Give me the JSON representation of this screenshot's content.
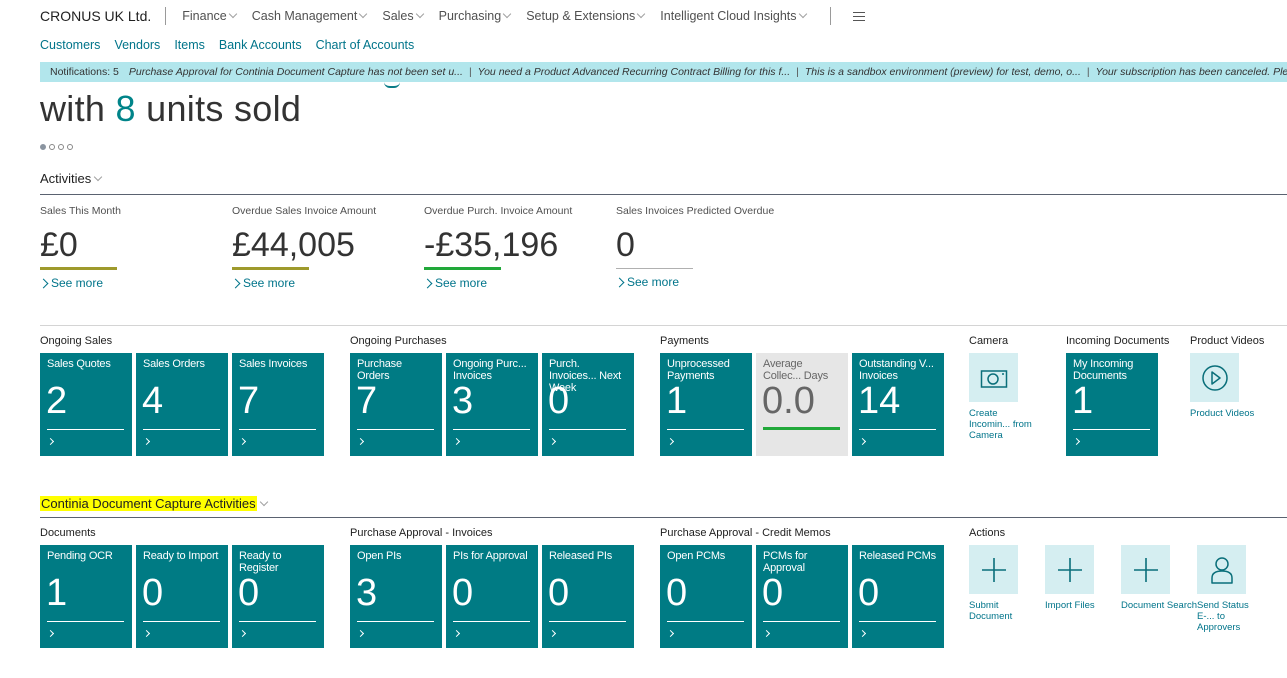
{
  "nav": {
    "company": "CRONUS UK Ltd.",
    "menus": [
      "Finance",
      "Cash Management",
      "Sales",
      "Purchasing",
      "Setup & Extensions",
      "Intelligent Cloud Insights"
    ]
  },
  "quick_links": [
    "Customers",
    "Vendors",
    "Items",
    "Bank Accounts",
    "Chart of Accounts"
  ],
  "notifications": {
    "count_label": "Notifications: 5",
    "messages": [
      "Purchase Approval for Continia Document Capture has not been set u...",
      "You need a Product Advanced Recurring Contract Billing for this f...",
      "This is a sandbox environment (preview) for test, demo, o...",
      "Your subscription has been canceled. Please buy"
    ],
    "separator": "|"
  },
  "headline": {
    "prefix": "with ",
    "accent": "8",
    "suffix": " units sold",
    "pager_count": 4,
    "pager_active": 1
  },
  "activities": {
    "title": "Activities",
    "kpis": [
      {
        "label": "Sales This Month",
        "value": "£0",
        "bar_color": "#9e9a2c",
        "see_more": "See more"
      },
      {
        "label": "Overdue Sales Invoice Amount",
        "value": "£44,005",
        "bar_color": "#9e9a2c",
        "see_more": "See more"
      },
      {
        "label": "Overdue Purch. Invoice Amount",
        "value": "-£35,196",
        "bar_color": "#21a83a",
        "see_more": "See more"
      },
      {
        "label": "Sales Invoices Predicted Overdue",
        "value": "0",
        "bar_color": "#b0b0b0",
        "see_more": "See more"
      }
    ],
    "groups": {
      "ongoing_sales": {
        "title": "Ongoing Sales",
        "tiles": [
          {
            "label": "Sales Quotes",
            "value": "2"
          },
          {
            "label": "Sales Orders",
            "value": "4"
          },
          {
            "label": "Sales Invoices",
            "value": "7"
          }
        ]
      },
      "ongoing_purchases": {
        "title": "Ongoing Purchases",
        "tiles": [
          {
            "label": "Purchase Orders",
            "value": "7"
          },
          {
            "label": "Ongoing Purc... Invoices",
            "value": "3"
          },
          {
            "label": "Purch. Invoices... Next Week",
            "value": "0"
          }
        ]
      },
      "payments": {
        "title": "Payments",
        "tiles": [
          {
            "label": "Unprocessed Payments",
            "value": "1"
          },
          {
            "label": "Average Collec... Days",
            "value": "0.0"
          },
          {
            "label": "Outstanding V... Invoices",
            "value": "14"
          }
        ]
      },
      "camera": {
        "title": "Camera",
        "action_label": "Create Incomin... from Camera"
      },
      "incoming_documents": {
        "title": "Incoming Documents",
        "tiles": [
          {
            "label": "My Incoming Documents",
            "value": "1"
          }
        ]
      },
      "product_videos": {
        "title": "Product Videos",
        "action_label": "Product Videos"
      }
    }
  },
  "continia": {
    "title": "Continia Document Capture Activities",
    "groups": {
      "documents": {
        "title": "Documents",
        "tiles": [
          {
            "label": "Pending OCR",
            "value": "1"
          },
          {
            "label": "Ready to Import",
            "value": "0"
          },
          {
            "label": "Ready to Register",
            "value": "0"
          }
        ]
      },
      "pa_invoices": {
        "title": "Purchase Approval - Invoices",
        "tiles": [
          {
            "label": "Open PIs",
            "value": "3"
          },
          {
            "label": "PIs for Approval",
            "value": "0"
          },
          {
            "label": "Released PIs",
            "value": "0"
          }
        ]
      },
      "pa_credit_memos": {
        "title": "Purchase Approval - Credit Memos",
        "tiles": [
          {
            "label": "Open PCMs",
            "value": "0"
          },
          {
            "label": "PCMs for Approval",
            "value": "0"
          },
          {
            "label": "Released PCMs",
            "value": "0"
          }
        ]
      },
      "actions": {
        "title": "Actions",
        "items": [
          {
            "label": "Submit Document",
            "icon": "plus-icon"
          },
          {
            "label": "Import Files",
            "icon": "plus-icon"
          },
          {
            "label": "Document Search",
            "icon": "plus-icon"
          },
          {
            "label": "Send Status E-... to Approvers",
            "icon": "person-icon"
          }
        ]
      }
    }
  },
  "colors": {
    "tile_teal": "#007b84",
    "link_teal": "#00748a",
    "notification_bg": "#b2e6ec",
    "action_bg": "#d5eef1",
    "highlight": "#ffff00"
  }
}
